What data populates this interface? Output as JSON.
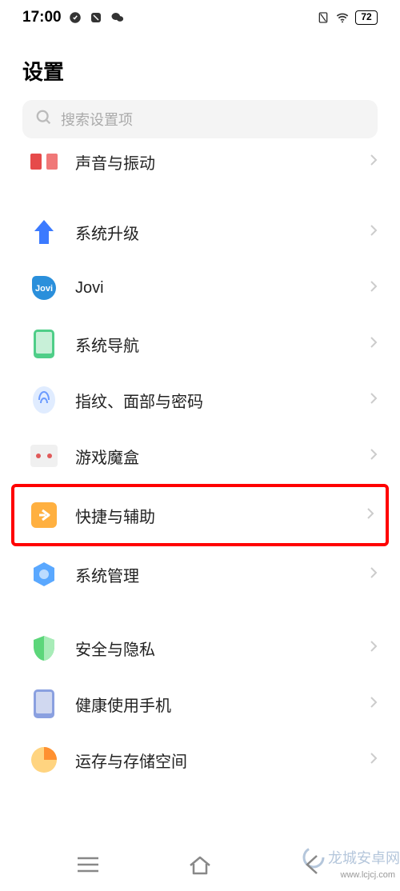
{
  "status": {
    "time": "17:00",
    "battery": "72"
  },
  "page": {
    "title": "设置"
  },
  "search": {
    "placeholder": "搜索设置项"
  },
  "items": {
    "sound": "声音与振动",
    "upgrade": "系统升级",
    "jovi": "Jovi",
    "nav": "系统导航",
    "fingerprint": "指纹、面部与密码",
    "game": "游戏魔盒",
    "shortcut": "快捷与辅助",
    "sysmgr": "系统管理",
    "safe": "安全与隐私",
    "health": "健康使用手机",
    "storage": "运存与存储空间"
  },
  "watermark": {
    "text": "龙城安卓网",
    "url": "www.lcjcj.com"
  }
}
